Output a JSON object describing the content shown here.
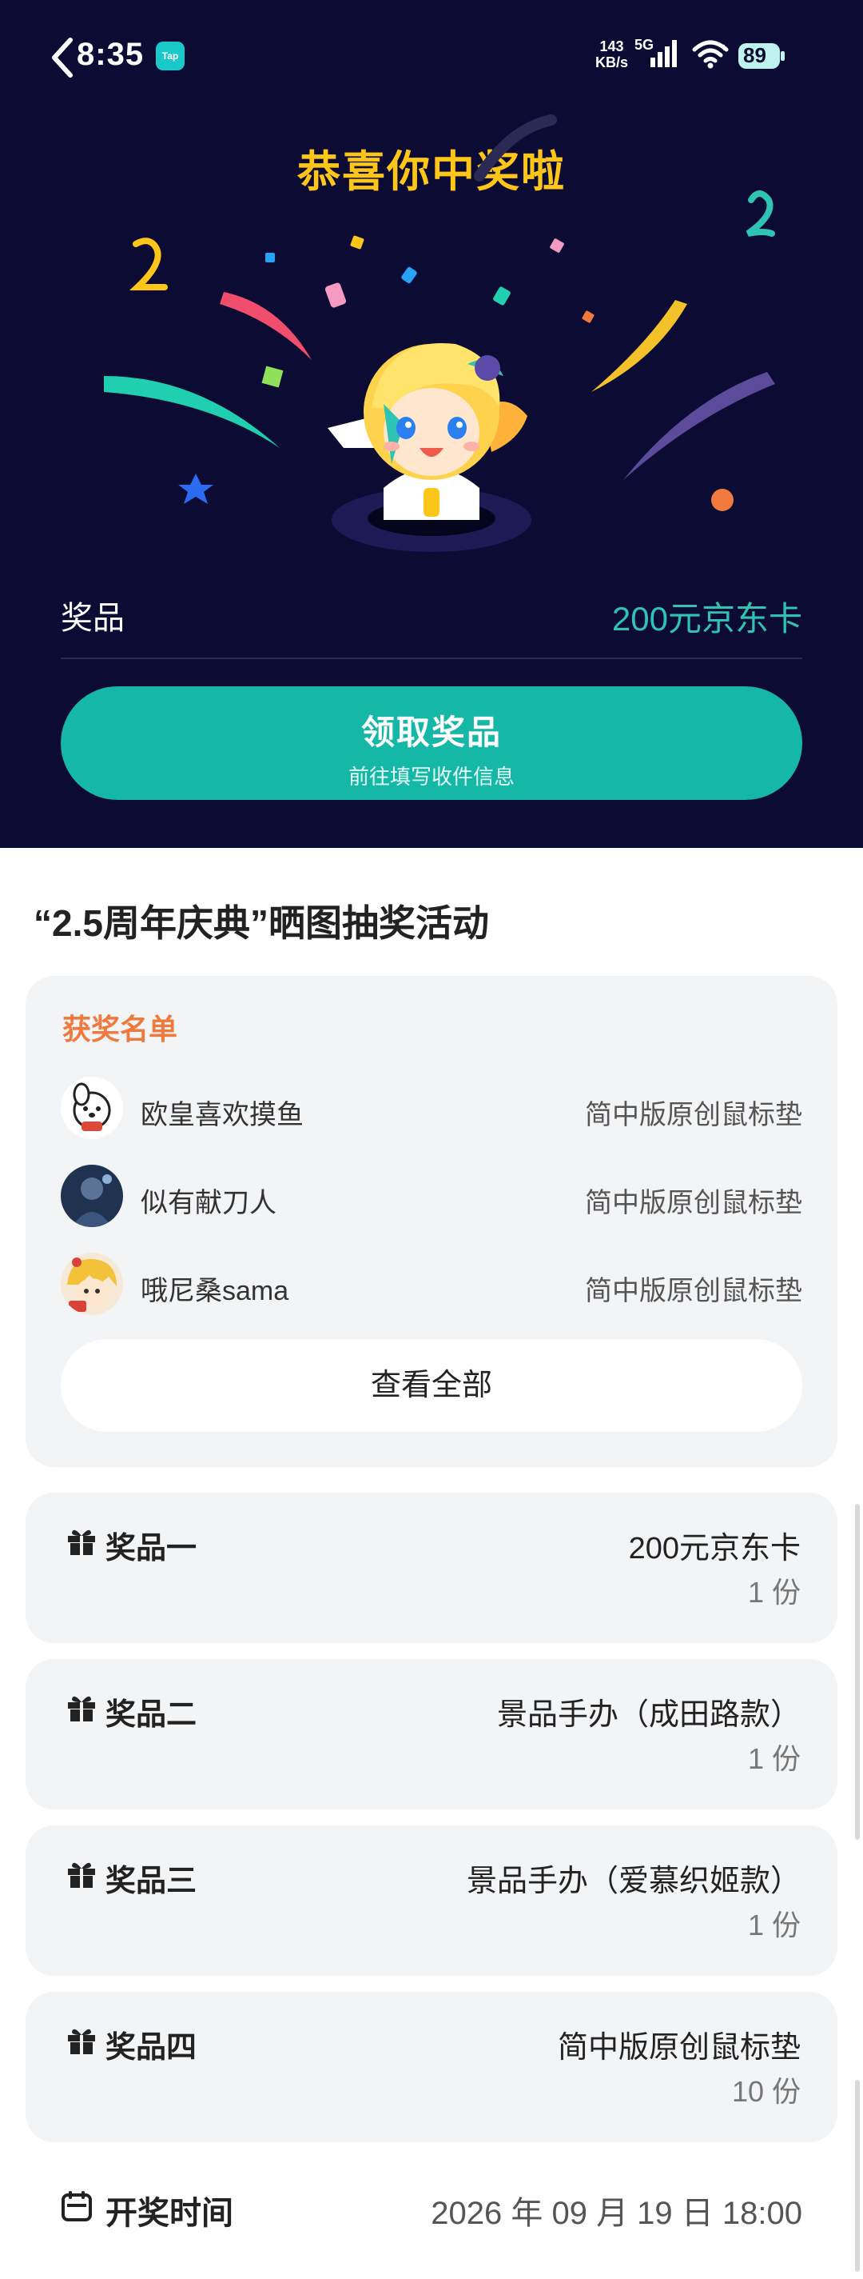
{
  "status_bar": {
    "time": "8:35",
    "app_badge": "Tap",
    "net_speed_value": "143",
    "net_speed_unit": "KB/s",
    "network": "5G",
    "battery": "89"
  },
  "hero": {
    "title": "恭喜你中奖啦",
    "prize_label": "奖品",
    "prize_value": "200元京东卡",
    "claim_button": "领取奖品",
    "claim_subtext": "前往填写收件信息"
  },
  "event": {
    "title": "“2.5周年庆典”晒图抽奖活动"
  },
  "winners": {
    "title": "获奖名单",
    "rows": [
      {
        "name": "欧皇喜欢摸鱼",
        "prize": "简中版原创鼠标垫"
      },
      {
        "name": "似有献刀人",
        "prize": "简中版原创鼠标垫"
      },
      {
        "name": "哦尼桑sama",
        "prize": "简中版原创鼠标垫"
      }
    ],
    "view_all": "查看全部"
  },
  "prizes": [
    {
      "title": "奖品一",
      "name": "200元京东卡",
      "qty": "1 份"
    },
    {
      "title": "奖品二",
      "name": "景品手办（成田路款）",
      "qty": "1 份"
    },
    {
      "title": "奖品三",
      "name": "景品手办（爱慕织姬款）",
      "qty": "1 份"
    },
    {
      "title": "奖品四",
      "name": "简中版原创鼠标垫",
      "qty": "10 份"
    }
  ],
  "draw_time": {
    "label": "开奖时间",
    "value": "2026 年 09 月 19 日 18:00"
  },
  "colors": {
    "hero_bg": "#0c0b33",
    "title_yellow": "#ffc61a",
    "accent_teal": "#15b7a6",
    "winners_title": "#f07a3e"
  }
}
